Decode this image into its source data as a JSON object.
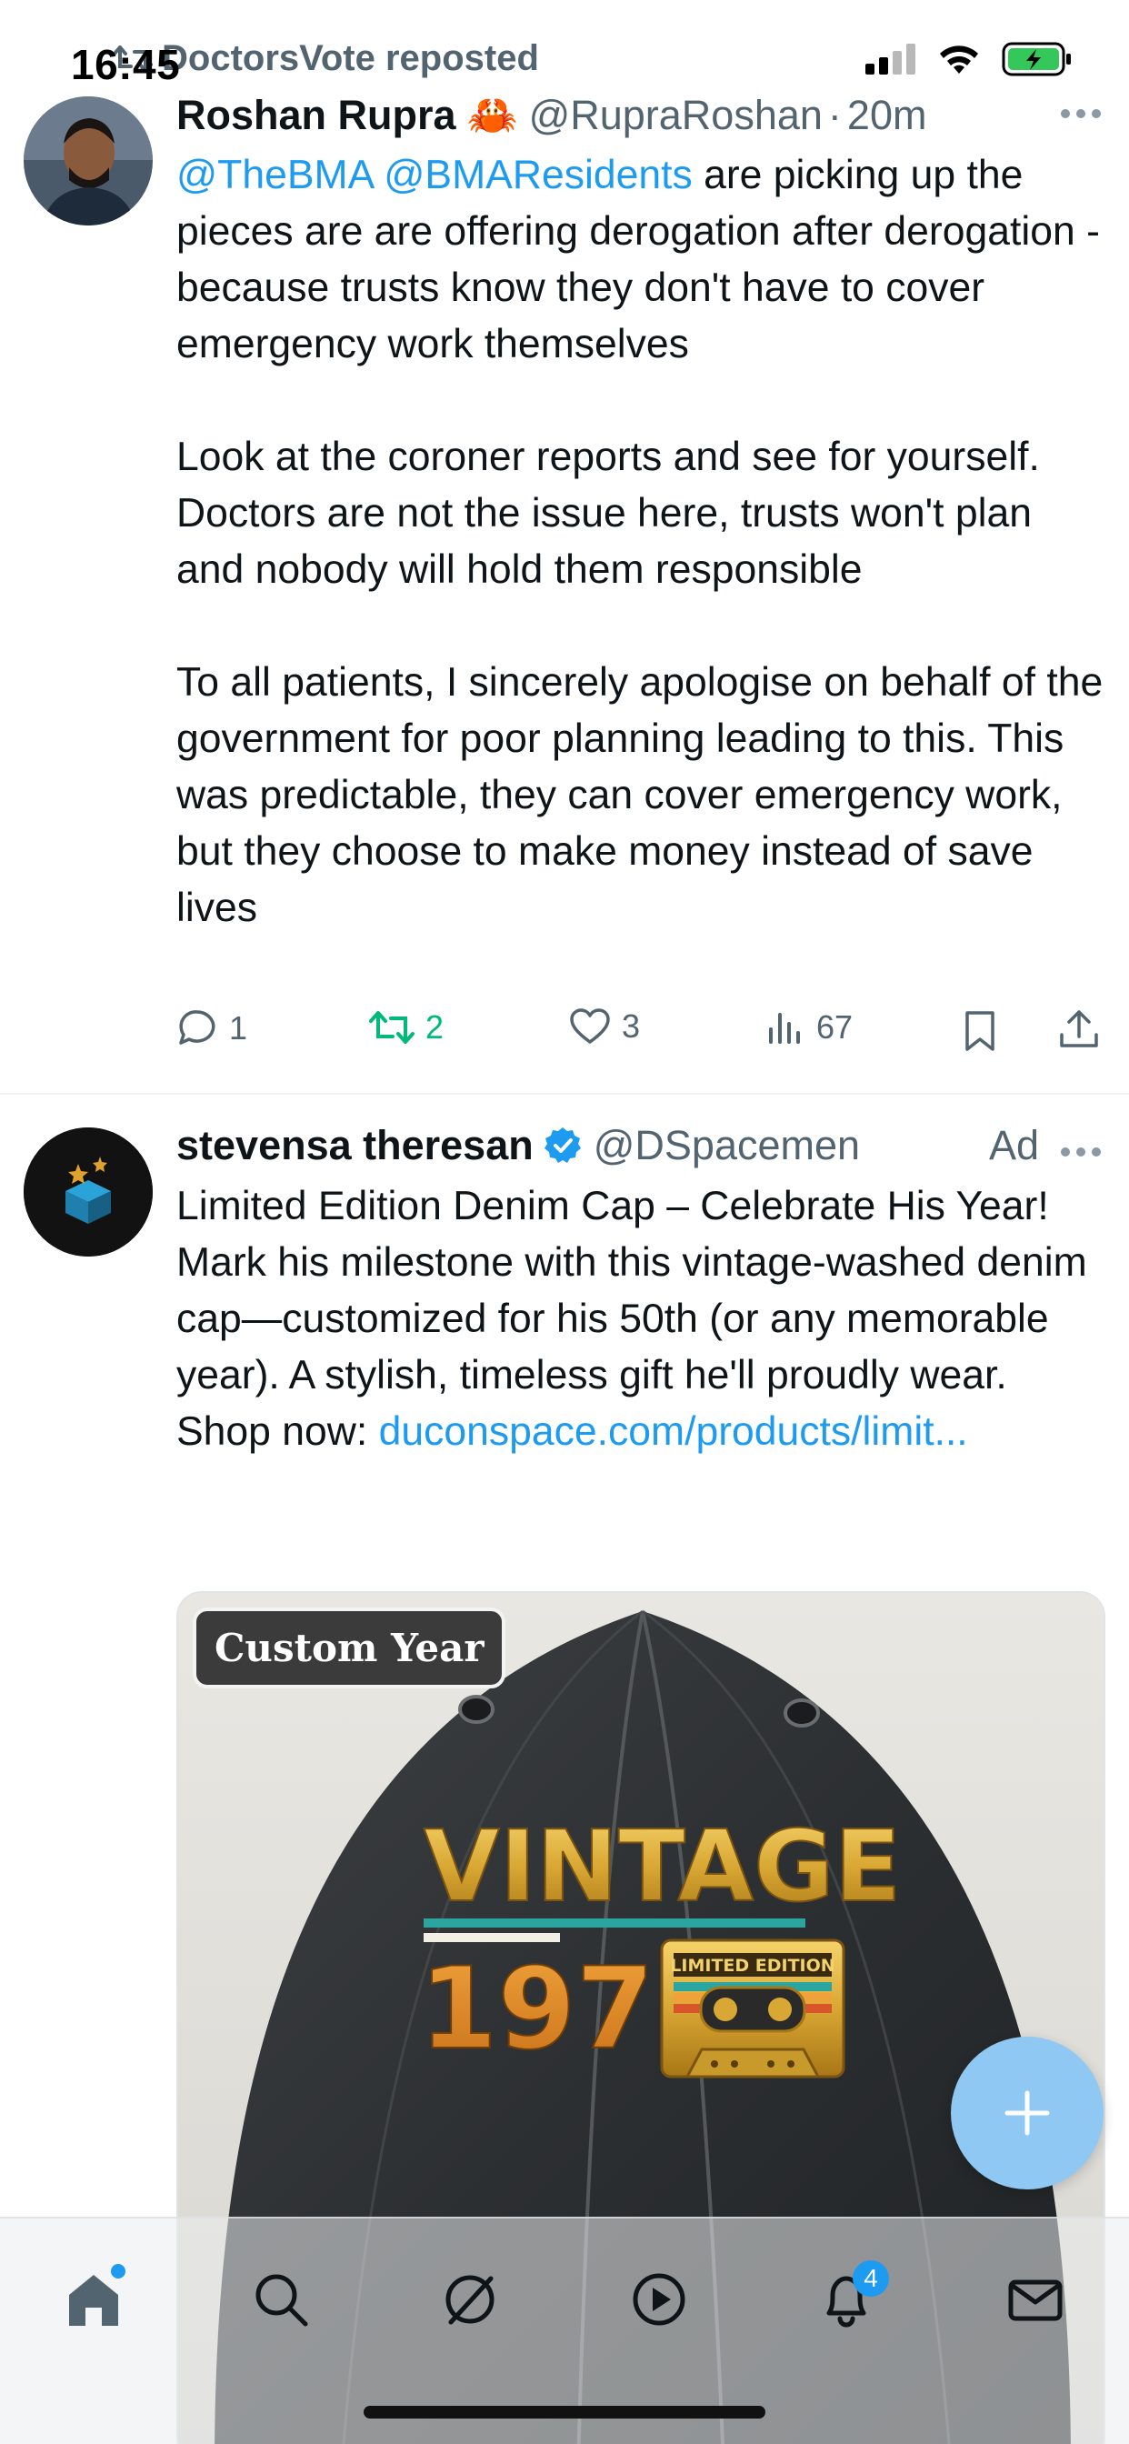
{
  "status_bar": {
    "time": "16:45"
  },
  "repost": {
    "text": "DoctorsVote reposted"
  },
  "tweet1": {
    "name": "Roshan Rupra",
    "emoji": "🦀",
    "handle": "@RupraRoshan",
    "separator": "·",
    "time": "20m",
    "mention1": "@TheBMA",
    "mention2": "@BMAResidents",
    "p1_rest": " are picking up the pieces are are offering derogation after derogation - because trusts know they don't have to cover emergency work themselves",
    "p2": "Look at the coroner reports and see for yourself. Doctors are not the issue here, trusts won't plan and nobody will hold them responsible",
    "p3": "To all patients, I sincerely apologise on behalf of the government for poor planning leading to this. This was predictable, they can cover emergency work, but they choose to make money instead of save lives",
    "replies": "1",
    "reposts": "2",
    "likes": "3",
    "views": "67"
  },
  "ad": {
    "name": "stevensa theresan",
    "handle": "@DSpacemen",
    "label": "Ad",
    "headline": "Limited Edition Denim Cap – Celebrate His Year!",
    "body": "Mark his milestone with this vintage-washed denim cap—customized for his 50th (or any memorable year). A stylish, timeless gift he'll proudly wear.",
    "shop_label": "Shop now: ",
    "link": "duconspace.com/products/limit...",
    "image_tag": "Custom Year",
    "cap_text_line1": "VINTAGE",
    "cap_text_year": "1975",
    "cap_badge": "LIMITED EDITION"
  },
  "nav": {
    "notifications_badge": "4"
  },
  "colors": {
    "accent": "#1d9bf0",
    "retweet_green": "#00ba7c",
    "secondary_text": "#536471"
  }
}
